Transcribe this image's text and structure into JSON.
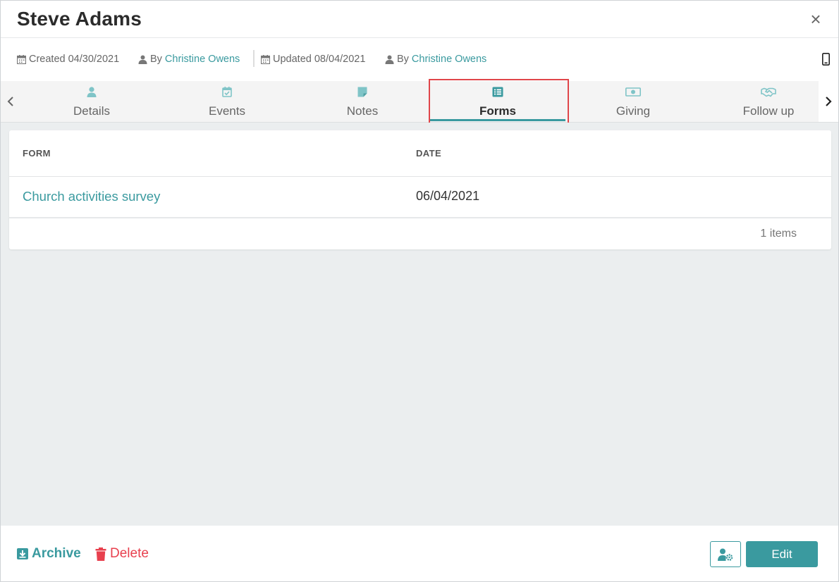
{
  "header": {
    "title": "Steve Adams",
    "close_icon": "close-icon",
    "close_glyph": "×"
  },
  "meta": {
    "created_text": "Created 04/30/2021",
    "created_by_prefix": "By",
    "created_by_name": "Christine Owens",
    "updated_text": "Updated 08/04/2021",
    "updated_by_prefix": "By",
    "updated_by_name": "Christine Owens",
    "device_icon": "mobile-phone-icon"
  },
  "tabs": {
    "items": [
      {
        "label": "Details",
        "icon": "person-icon"
      },
      {
        "label": "Events",
        "icon": "calendar-check-icon"
      },
      {
        "label": "Notes",
        "icon": "sticky-note-icon"
      },
      {
        "label": "Forms",
        "icon": "list-icon",
        "active": true
      },
      {
        "label": "Giving",
        "icon": "money-icon"
      },
      {
        "label": "Follow up",
        "icon": "handshake-icon"
      }
    ],
    "active_index": 3
  },
  "table": {
    "columns": [
      "FORM",
      "DATE"
    ],
    "rows": [
      {
        "form": "Church activities survey",
        "date": "06/04/2021"
      }
    ],
    "count_text": "1 items"
  },
  "footer": {
    "archive_label": "Archive",
    "delete_label": "Delete",
    "edit_label": "Edit"
  },
  "colors": {
    "accent": "#3a9a9f",
    "danger": "#e8404e",
    "highlight": "#e0464a",
    "tab_icon": "#7fc4c7"
  }
}
